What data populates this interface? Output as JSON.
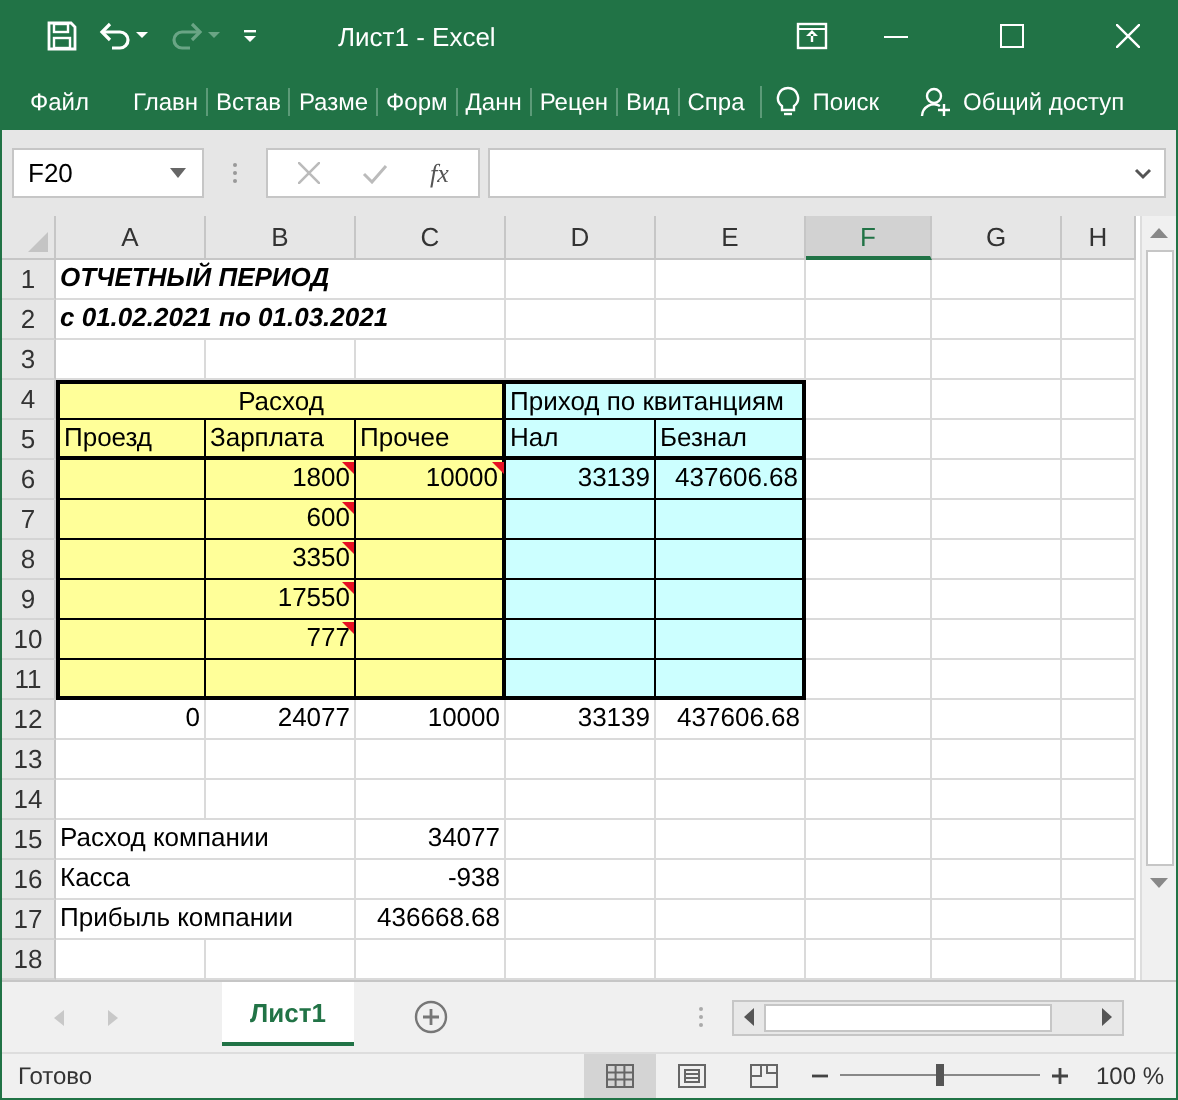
{
  "title_bar": {
    "title": "Лист1 - Excel"
  },
  "ribbon_tabs": [
    "Файл",
    "Главн",
    "Встав",
    "Разме",
    "Форм",
    "Данн",
    "Рецен",
    "Вид",
    "Спра"
  ],
  "search": "Поиск",
  "share": "Общий доступ",
  "formula_bar": {
    "name_box": "F20",
    "function_label": "fx"
  },
  "sheet": {
    "columns": [
      {
        "label": "A",
        "selected": false
      },
      {
        "label": "B",
        "selected": false
      },
      {
        "label": "C",
        "selected": false
      },
      {
        "label": "D",
        "selected": false
      },
      {
        "label": "E",
        "selected": false
      },
      {
        "label": "F",
        "selected": true
      },
      {
        "label": "G",
        "selected": false
      },
      {
        "label": "H",
        "selected": false
      }
    ],
    "rows": [
      {
        "number": "1",
        "cells": [
          {
            "kind": "text",
            "text": "ОТЧЕТНЫЙ ПЕРИОД",
            "bold_italic": true
          },
          {},
          {}
        ]
      },
      {
        "number": "2",
        "cells": [
          {
            "kind": "text",
            "text": "с 01.02.2021 по 01.03.2021",
            "bold_italic": true
          },
          {},
          {}
        ]
      },
      {
        "number": "3",
        "cells": []
      },
      {
        "number": "4",
        "cells": [
          {
            "kind": "text",
            "text": "Расход",
            "centered": true,
            "color": "#ffff99"
          },
          {
            "color": "#ffff99"
          },
          {
            "color": "#ffff99"
          },
          {
            "kind": "text",
            "text": "Приход по квитанциям",
            "color": "#ccffff"
          },
          {
            "color": "#ccffff"
          }
        ]
      },
      {
        "number": "5",
        "thick_rule_below": true,
        "cells": [
          {
            "kind": "text",
            "text": "Проезд",
            "color": "#ffff99"
          },
          {
            "kind": "text",
            "text": "Зарплата",
            "color": "#ffff99"
          },
          {
            "kind": "text",
            "text": "Прочее",
            "color": "#ffff99"
          },
          {
            "kind": "text",
            "text": "Нал",
            "color": "#ccffff"
          },
          {
            "kind": "text",
            "text": "Безнал",
            "color": "#ccffff"
          }
        ]
      },
      {
        "number": "6",
        "cells": [
          {
            "color": "#ffff99"
          },
          {
            "kind": "number",
            "text": "1800",
            "comment": true,
            "color": "#ffff99"
          },
          {
            "kind": "number",
            "text": "10000",
            "comment": true,
            "color": "#ffff99"
          },
          {
            "kind": "number",
            "text": "33139",
            "color": "#ccffff"
          },
          {
            "kind": "number",
            "text": "437606.68",
            "color": "#ccffff"
          }
        ]
      },
      {
        "number": "7",
        "cells": [
          {
            "color": "#ffff99"
          },
          {
            "kind": "number",
            "text": "600",
            "comment": true,
            "color": "#ffff99"
          },
          {
            "color": "#ffff99"
          },
          {
            "color": "#ccffff"
          },
          {
            "color": "#ccffff"
          }
        ]
      },
      {
        "number": "8",
        "cells": [
          {
            "color": "#ffff99"
          },
          {
            "kind": "number",
            "text": "3350",
            "comment": true,
            "color": "#ffff99"
          },
          {
            "color": "#ffff99"
          },
          {
            "color": "#ccffff"
          },
          {
            "color": "#ccffff"
          }
        ]
      },
      {
        "number": "9",
        "cells": [
          {
            "color": "#ffff99"
          },
          {
            "kind": "number",
            "text": "17550",
            "comment": true,
            "color": "#ffff99"
          },
          {
            "color": "#ffff99"
          },
          {
            "color": "#ccffff"
          },
          {
            "color": "#ccffff"
          }
        ]
      },
      {
        "number": "10",
        "cells": [
          {
            "color": "#ffff99"
          },
          {
            "kind": "number",
            "text": "777",
            "comment": true,
            "color": "#ffff99"
          },
          {
            "color": "#ffff99"
          },
          {
            "color": "#ccffff"
          },
          {
            "color": "#ccffff"
          }
        ]
      },
      {
        "number": "11",
        "cells": [
          {
            "color": "#ffff99"
          },
          {
            "color": "#ffff99"
          },
          {
            "color": "#ffff99"
          },
          {
            "color": "#ccffff"
          },
          {
            "color": "#ccffff"
          }
        ]
      },
      {
        "number": "12",
        "cells": [
          {
            "kind": "number",
            "text": "0"
          },
          {
            "kind": "number",
            "text": "24077"
          },
          {
            "kind": "number",
            "text": "10000"
          },
          {
            "kind": "number",
            "text": "33139"
          },
          {
            "kind": "number",
            "text": "437606.68"
          }
        ]
      },
      {
        "number": "13",
        "cells": []
      },
      {
        "number": "14",
        "cells": []
      },
      {
        "number": "15",
        "cells": [
          {
            "kind": "text",
            "text": "Расход компании"
          },
          {},
          {
            "kind": "number",
            "text": "34077"
          }
        ]
      },
      {
        "number": "16",
        "cells": [
          {
            "kind": "text",
            "text": "Касса"
          },
          {},
          {
            "kind": "number",
            "text": "-938"
          }
        ]
      },
      {
        "number": "17",
        "cells": [
          {
            "kind": "text",
            "text": "Прибыль компании"
          },
          {},
          {
            "kind": "number",
            "text": "436668.68"
          }
        ]
      },
      {
        "number": "18",
        "cells": []
      }
    ]
  },
  "sheet_tabs": [
    {
      "label": "Лист1",
      "selected": true
    }
  ],
  "status_bar": {
    "status": "Готово",
    "views": [
      {
        "kind": "normal",
        "selected": true
      },
      {
        "kind": "page-layout",
        "selected": false
      },
      {
        "kind": "page-break",
        "selected": false
      }
    ],
    "zoom": {
      "level": 0.5,
      "reading": "100 %"
    }
  }
}
